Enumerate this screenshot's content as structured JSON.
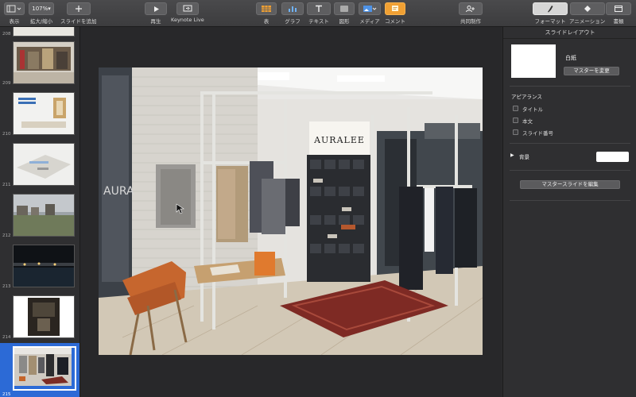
{
  "toolbar": {
    "view_label": "表示",
    "zoom_value": "107%",
    "zoom_label": "拡大/縮小",
    "add_slide_label": "スライドを追加",
    "play_label": "再生",
    "keynote_live_label": "Keynote Live",
    "table_label": "表",
    "chart_label": "グラフ",
    "text_label": "テキスト",
    "shape_label": "図形",
    "media_label": "メディア",
    "comment_label": "コメント",
    "collaborate_label": "共同制作",
    "format_label": "フォーマット",
    "animate_label": "アニメーション",
    "document_label": "書類"
  },
  "sidebar": {
    "slides": [
      {
        "number": "208",
        "theme": "shop-interior"
      },
      {
        "number": "209",
        "theme": "display-stand"
      },
      {
        "number": "210",
        "theme": "architecture-model"
      },
      {
        "number": "211",
        "theme": "field-buildings"
      },
      {
        "number": "212",
        "theme": "night-waterfront"
      },
      {
        "number": "213",
        "theme": "dim-interior"
      },
      {
        "number": "214",
        "theme": "dark-room"
      },
      {
        "number": "215",
        "theme": "apparel-store",
        "selected": true
      }
    ]
  },
  "canvas": {
    "slide": {
      "sign_text": "AURALEE",
      "window_text": "AURA",
      "content": "Photograph of a clothing store: racks of garments on white pipe racks, a shoe display, a red patterned rug and an orange lounge chair"
    }
  },
  "inspector": {
    "panel_title": "スライドレイアウト",
    "layout_name": "白紙",
    "change_master_button": "マスターを変更",
    "appearance_heading": "アピアランス",
    "options": [
      {
        "label": "タイトル",
        "checked": false
      },
      {
        "label": "本文",
        "checked": false
      },
      {
        "label": "スライド番号",
        "checked": false
      }
    ],
    "background_label": "背景",
    "background_color": "#ffffff",
    "edit_master_button": "マスタースライドを編集"
  },
  "colors": {
    "accent": "#f0a033",
    "selection": "#2c6ad6",
    "toolbar_bg": "#3c3c3e",
    "panel_bg": "#2f2f31"
  }
}
